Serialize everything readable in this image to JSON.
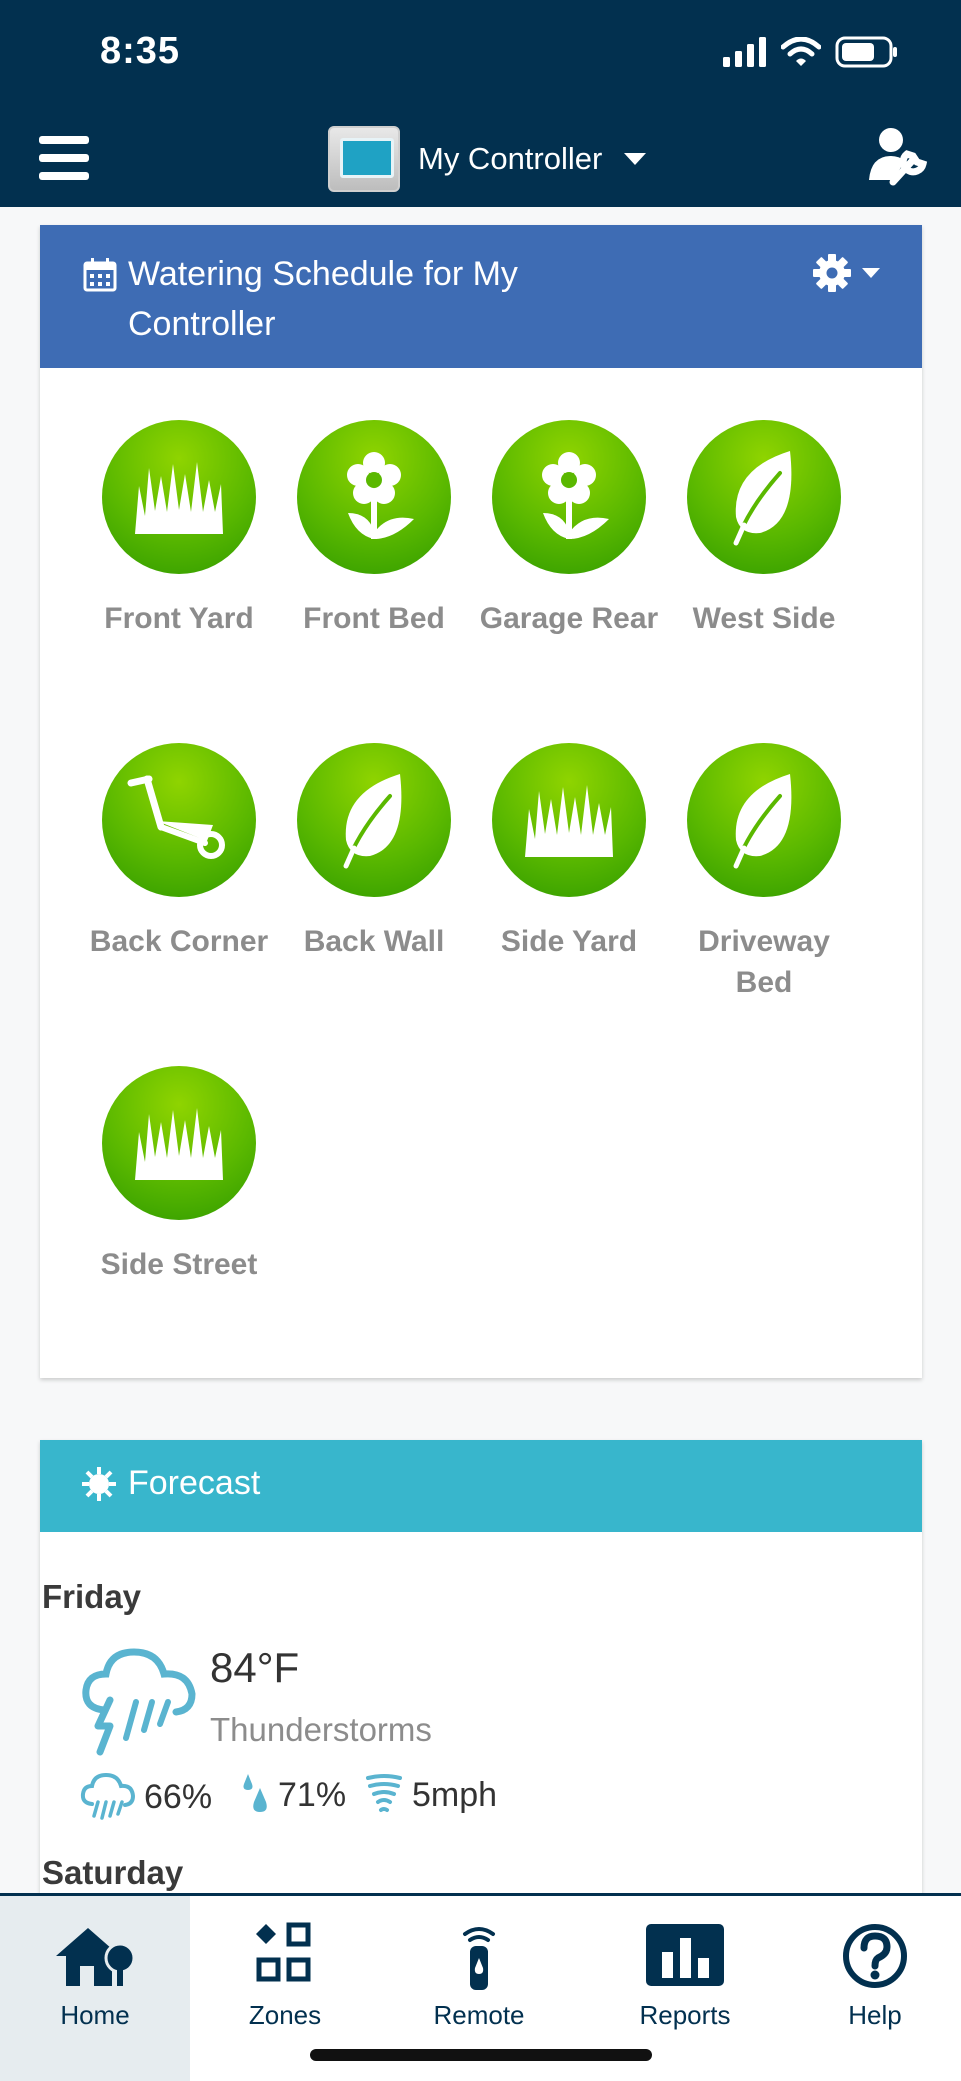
{
  "status_bar": {
    "time": "8:35"
  },
  "header": {
    "controller_name": "My Controller"
  },
  "schedule": {
    "title": "Watering Schedule for My Controller",
    "zones": [
      {
        "name": "Front Yard",
        "icon": "grass-icon"
      },
      {
        "name": "Front Bed",
        "icon": "flower-icon"
      },
      {
        "name": "Garage Rear",
        "icon": "flower-icon"
      },
      {
        "name": "West Side",
        "icon": "leaf-icon"
      },
      {
        "name": "Back Corner",
        "icon": "wheelbarrow-icon"
      },
      {
        "name": "Back Wall",
        "icon": "leaf-icon"
      },
      {
        "name": "Side Yard",
        "icon": "grass-icon"
      },
      {
        "name": "Driveway Bed",
        "icon": "leaf-icon"
      },
      {
        "name": "Side Street",
        "icon": "grass-icon"
      }
    ]
  },
  "forecast": {
    "title": "Forecast",
    "days": [
      {
        "day": "Friday",
        "temperature": "84°F",
        "condition": "Thunderstorms",
        "precip_chance": "66%",
        "humidity": "71%",
        "wind": "5mph"
      },
      {
        "day": "Saturday"
      }
    ]
  },
  "tabs": [
    {
      "label": "Home",
      "icon": "home-icon",
      "active": true
    },
    {
      "label": "Zones",
      "icon": "zones-icon",
      "active": false
    },
    {
      "label": "Remote",
      "icon": "remote-icon",
      "active": false
    },
    {
      "label": "Reports",
      "icon": "reports-icon",
      "active": false
    },
    {
      "label": "Help",
      "icon": "help-icon",
      "active": false
    }
  ],
  "colors": {
    "header_bg": "#02304f",
    "schedule_header": "#3e6cb4",
    "forecast_header": "#38b6cc",
    "zone_green": "#5ab800"
  }
}
